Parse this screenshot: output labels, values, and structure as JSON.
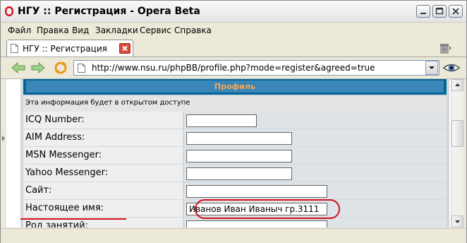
{
  "window": {
    "title": "НГУ :: Регистрация - Opera Beta",
    "controls": [
      "minimize",
      "maximize",
      "close"
    ]
  },
  "menu": {
    "items": [
      "Файл",
      "Правка",
      "Вид",
      "Закладки",
      "Сервис",
      "Справка"
    ]
  },
  "tabs": [
    {
      "label": "НГУ :: Регистрация",
      "active": true
    }
  ],
  "navigation": {
    "url": "http://www.nsu.ru/phpBB/profile.php?mode=register&agreed=true"
  },
  "panel": {
    "title": "Профиль",
    "info": "Эта информация будет в открытом доступе"
  },
  "form": {
    "fields": [
      {
        "label": "ICQ Number:",
        "value": ""
      },
      {
        "label": "AIM Address:",
        "value": ""
      },
      {
        "label": "MSN Messenger:",
        "value": ""
      },
      {
        "label": "Yahoo Messenger:",
        "value": ""
      },
      {
        "label": "Сайт:",
        "value": ""
      },
      {
        "label": "Настоящее имя:",
        "value": "Иванов Иван Иваныч гр.3111"
      },
      {
        "label": "Род занятий:",
        "value": ""
      }
    ]
  },
  "annotation": {
    "color": "#d2111d"
  }
}
